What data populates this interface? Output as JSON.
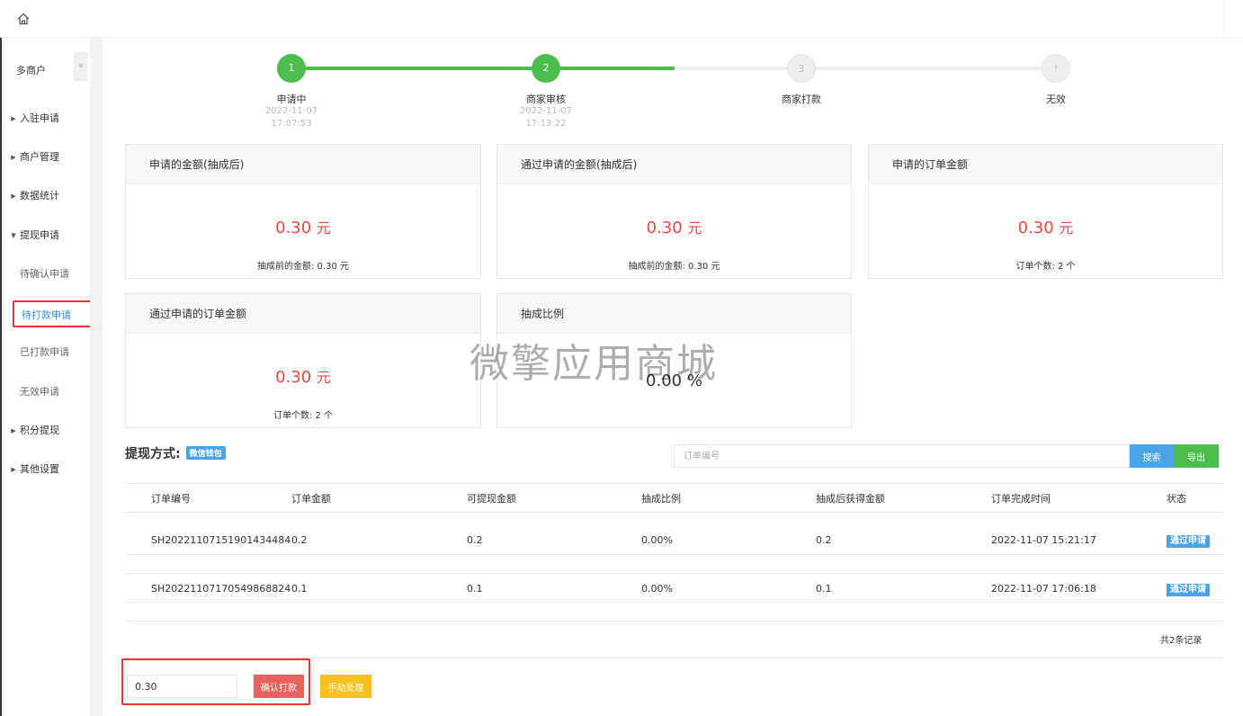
{
  "sidebar": {
    "title": "多商户",
    "collapse": "«",
    "items": [
      {
        "label": "入驻申请",
        "arrow": "▶"
      },
      {
        "label": "商户管理",
        "arrow": "▶"
      },
      {
        "label": "数据统计",
        "arrow": "▶"
      },
      {
        "label": "提现申请",
        "arrow": "▼"
      },
      {
        "label": "积分提现",
        "arrow": "▶"
      },
      {
        "label": "其他设置",
        "arrow": "▶"
      }
    ],
    "sub_items": [
      {
        "label": "待确认申请"
      },
      {
        "label": "待打款申请"
      },
      {
        "label": "已打款申请"
      },
      {
        "label": "无效申请"
      }
    ]
  },
  "steps": [
    {
      "num": "1",
      "label": "申请中",
      "date": "2022-11-07",
      "time": "17:07:53"
    },
    {
      "num": "2",
      "label": "商家审核",
      "date": "2022-11-07",
      "time": "17:13:22"
    },
    {
      "num": "3",
      "label": "商家打款"
    },
    {
      "num": "!",
      "label": "无效"
    }
  ],
  "cards": [
    {
      "title": "申请的金额(抽成后)",
      "value": "0.30",
      "unit": "元",
      "sub": "抽成前的金额: 0.30 元"
    },
    {
      "title": "通过申请的金额(抽成后)",
      "value": "0.30",
      "unit": "元",
      "sub": "抽成前的金额: 0.30 元"
    },
    {
      "title": "申请的订单金额",
      "value": "0.30",
      "unit": "元",
      "sub": "订单个数: 2 个"
    },
    {
      "title": "通过申请的订单金额",
      "value": "0.30",
      "unit": "元",
      "sub": "订单个数: 2 个"
    },
    {
      "title": "抽成比例",
      "value": "0.00 %"
    }
  ],
  "watermark": "微擎应用商城",
  "method": {
    "label": "提现方式:",
    "badge": "微信钱包"
  },
  "search": {
    "placeholder": "订单编号",
    "search_label": "搜索",
    "export_label": "导出"
  },
  "table": {
    "headers": [
      "订单编号",
      "订单金额",
      "可提现金额",
      "抽成比例",
      "抽成后获得金额",
      "订单完成时间",
      "状态"
    ],
    "rows": [
      [
        "SH20221107151901434484",
        "0.2",
        "0.2",
        "0.00%",
        "0.2",
        "2022-11-07 15:21:17",
        "通过申请"
      ],
      [
        "SH20221107170549868824",
        "0.1",
        "0.1",
        "0.00%",
        "0.1",
        "2022-11-07 17:06:18",
        "通过申请"
      ]
    ]
  },
  "total": "共2条记录",
  "payment": {
    "amount": "0.30",
    "confirm_label": "确认打款",
    "manual_label": "手动处理"
  },
  "colors": {
    "primary": "#4aa3e6",
    "success": "#4cbc4e",
    "danger": "#e44444",
    "warning": "#f5c020",
    "highlight": "#e33333"
  }
}
